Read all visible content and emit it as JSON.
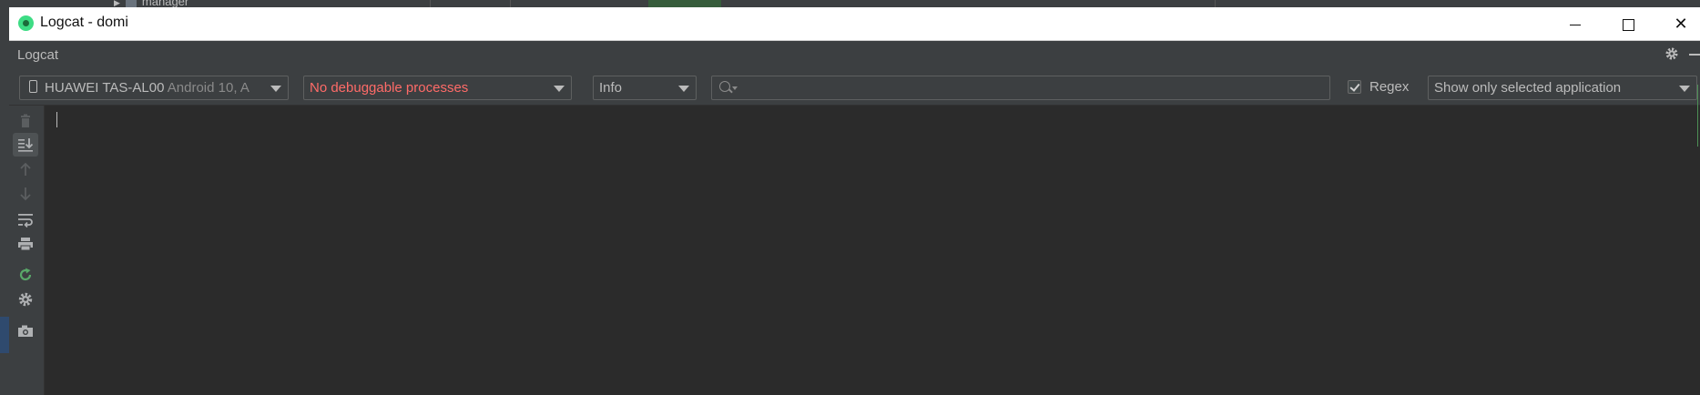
{
  "background": {
    "tree_item": "manager"
  },
  "window": {
    "title": "Logcat - domi",
    "minimize_glyph": "",
    "maximize_glyph": "",
    "close_glyph": "✕"
  },
  "panel": {
    "name": "Logcat"
  },
  "toolbar": {
    "device": {
      "name": "HUAWEI TAS-AL00",
      "version": "Android 10, A"
    },
    "process": "No debuggable processes",
    "log_level": "Info",
    "search": {
      "value": "",
      "placeholder": ""
    },
    "regex": {
      "label": "Regex",
      "checked": true
    },
    "filter": "Show only selected application"
  },
  "sidebar_tools": [
    {
      "icon": "trash-icon",
      "active": false,
      "enabled": false
    },
    {
      "icon": "scroll-to-end-icon",
      "active": true,
      "enabled": true
    },
    {
      "icon": "arrow-up-icon",
      "active": false,
      "enabled": false
    },
    {
      "icon": "arrow-down-icon",
      "active": false,
      "enabled": false
    },
    {
      "icon": "soft-wrap-icon",
      "active": false,
      "enabled": true
    },
    {
      "icon": "print-icon",
      "active": false,
      "enabled": true
    },
    {
      "icon": "restart-icon",
      "active": false,
      "enabled": true
    },
    {
      "icon": "gear-icon",
      "active": false,
      "enabled": true
    },
    {
      "icon": "camera-icon",
      "active": false,
      "enabled": true
    }
  ],
  "colors": {
    "process_error": "#ff6b68",
    "restart_green": "#59a869"
  }
}
